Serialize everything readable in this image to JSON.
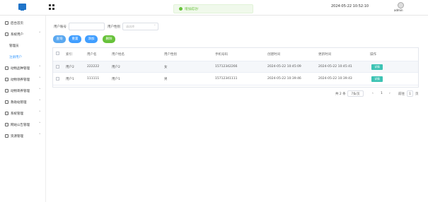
{
  "header": {
    "system_title": "平台",
    "datetime": "2024-05-22 10:52:10",
    "username": "admin"
  },
  "toast": {
    "message": "增加成功!"
  },
  "sidebar": {
    "items": [
      {
        "label": "后台首页",
        "icon": "home-icon",
        "has_arrow": false
      },
      {
        "label": "系统用户",
        "icon": "user-icon",
        "has_arrow": true
      },
      {
        "label": "管理员",
        "sub": true
      },
      {
        "label": "注册用户",
        "sub": true,
        "active": true
      },
      {
        "label": "动物品种管理",
        "icon": "list-icon",
        "has_arrow": true
      },
      {
        "label": "动物领养管理",
        "icon": "list-icon",
        "has_arrow": true
      },
      {
        "label": "动物寄养管理",
        "icon": "list-icon",
        "has_arrow": true
      },
      {
        "label": "救助站管理",
        "icon": "list-icon",
        "has_arrow": true
      },
      {
        "label": "系统管理",
        "icon": "gear-icon",
        "has_arrow": true
      },
      {
        "label": "网站公告管理",
        "icon": "bell-icon",
        "has_arrow": true
      },
      {
        "label": "资源管理",
        "icon": "folder-icon",
        "has_arrow": true
      }
    ]
  },
  "search": {
    "account_label": "用户账号",
    "account_placeholder": "",
    "gender_label": "用户性别",
    "gender_placeholder": "请选择"
  },
  "buttons": {
    "query": "查询",
    "reset": "重置",
    "add": "添加",
    "delete": "删除"
  },
  "table": {
    "headers": [
      "索引",
      "用户名",
      "用户姓名",
      "用户性别",
      "手机号码",
      "创建时间",
      "更新时间",
      "操作"
    ],
    "rows": [
      [
        "用户2",
        "222222",
        "用户2",
        "女",
        "15712342266",
        "2024-05-22 10:45:09",
        "2024-05-22 10:45:41"
      ],
      [
        "用户1",
        "111111",
        "用户1",
        "男",
        "15712341111",
        "2024-05-22 10:39:46",
        "2024-05-22 10:39:43"
      ]
    ],
    "detail_label": "详情"
  },
  "pagination": {
    "total": "共 2 条",
    "page_size": "7条/页",
    "prev": "‹",
    "current_page": "1",
    "next": "›",
    "goto_label": "前往",
    "goto_value": "1",
    "page_suffix": "页"
  },
  "colors": {
    "query": "#409eff",
    "reset": "#409eff",
    "add": "#409eff",
    "delete": "#67c23a",
    "detail": "#3dc3b4"
  }
}
